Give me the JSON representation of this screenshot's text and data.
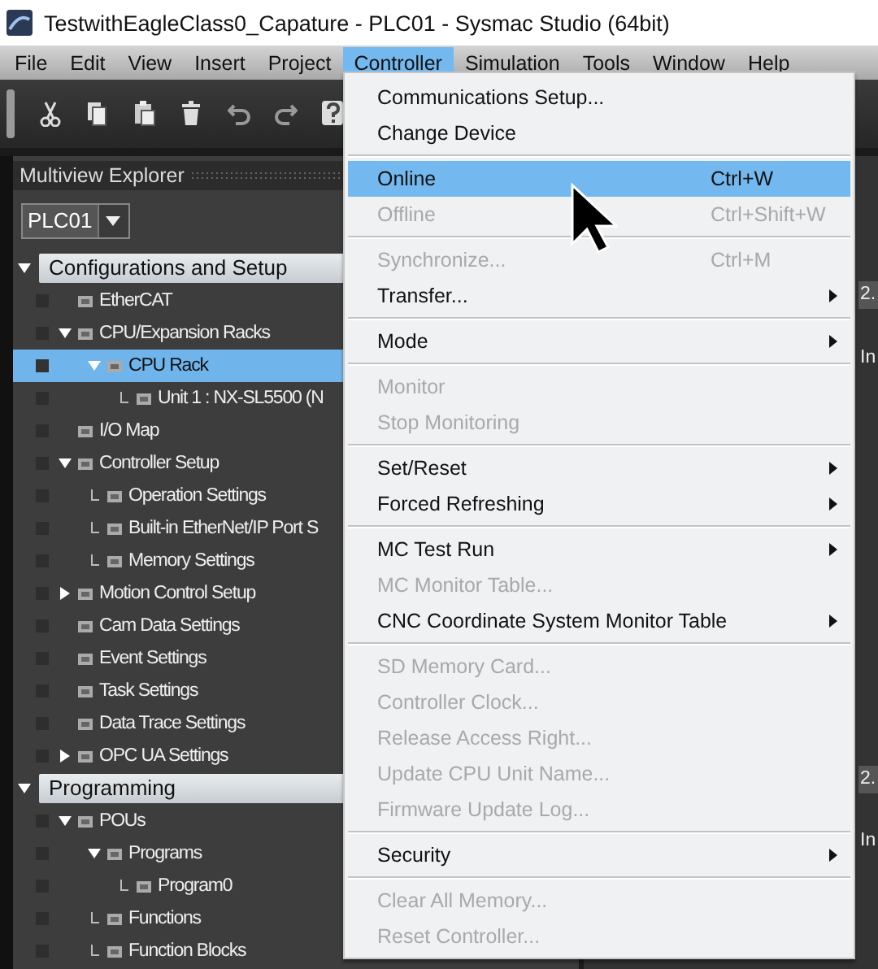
{
  "window": {
    "title": "TestwithEagleClass0_Capature - PLC01 - Sysmac Studio (64bit)"
  },
  "menu_bar": [
    {
      "label": "File",
      "selected": false
    },
    {
      "label": "Edit",
      "selected": false
    },
    {
      "label": "View",
      "selected": false
    },
    {
      "label": "Insert",
      "selected": false
    },
    {
      "label": "Project",
      "selected": false
    },
    {
      "label": "Controller",
      "selected": true
    },
    {
      "label": "Simulation",
      "selected": false
    },
    {
      "label": "Tools",
      "selected": false
    },
    {
      "label": "Window",
      "selected": false
    },
    {
      "label": "Help",
      "selected": false
    }
  ],
  "explorer": {
    "title": "Multiview Explorer",
    "device": "PLC01",
    "sections": [
      {
        "label": "Configurations and Setup",
        "expanded": true,
        "children": [
          {
            "label": "EtherCAT",
            "selected": false
          },
          {
            "label": "CPU/Expansion Racks",
            "selected": false,
            "expanded": true,
            "children": [
              {
                "label": "CPU Rack",
                "selected": true,
                "expanded": true,
                "children": [
                  {
                    "label": "Unit 1 : NX-SL5500 (N",
                    "selected": false
                  }
                ]
              }
            ]
          },
          {
            "label": "I/O Map",
            "selected": false
          },
          {
            "label": "Controller Setup",
            "selected": false,
            "expanded": true,
            "children": [
              {
                "label": "Operation Settings",
                "selected": false
              },
              {
                "label": "Built-in EtherNet/IP Port S",
                "selected": false
              },
              {
                "label": "Memory Settings",
                "selected": false
              }
            ]
          },
          {
            "label": "Motion Control Setup",
            "selected": false,
            "expanded": false
          },
          {
            "label": "Cam Data Settings",
            "selected": false
          },
          {
            "label": "Event Settings",
            "selected": false
          },
          {
            "label": "Task Settings",
            "selected": false
          },
          {
            "label": "Data Trace Settings",
            "selected": false
          },
          {
            "label": "OPC UA Settings",
            "selected": false,
            "expanded": false
          }
        ]
      },
      {
        "label": "Programming",
        "expanded": true,
        "children": [
          {
            "label": "POUs",
            "selected": false,
            "expanded": true,
            "children": [
              {
                "label": "Programs",
                "selected": false,
                "expanded": true,
                "children": [
                  {
                    "label": "Program0",
                    "selected": false
                  }
                ]
              },
              {
                "label": "Functions",
                "selected": false
              },
              {
                "label": "Function Blocks",
                "selected": false
              }
            ]
          }
        ]
      }
    ]
  },
  "workspace": {
    "fragments": [
      "2.",
      "In",
      "2.",
      "In"
    ]
  },
  "controller_menu": [
    {
      "kind": "item",
      "label": "Communications Setup...",
      "disabled": false,
      "selected": false
    },
    {
      "kind": "item",
      "label": "Change Device",
      "disabled": false,
      "selected": false
    },
    {
      "kind": "separator"
    },
    {
      "kind": "item",
      "label": "Online",
      "shortcut": "Ctrl+W",
      "disabled": false,
      "selected": true
    },
    {
      "kind": "item",
      "label": "Offline",
      "shortcut": "Ctrl+Shift+W",
      "disabled": true,
      "selected": false
    },
    {
      "kind": "separator"
    },
    {
      "kind": "item",
      "label": "Synchronize...",
      "shortcut": "Ctrl+M",
      "disabled": true,
      "selected": false
    },
    {
      "kind": "submenu",
      "label": "Transfer...",
      "disabled": false,
      "selected": false
    },
    {
      "kind": "separator"
    },
    {
      "kind": "submenu",
      "label": "Mode",
      "disabled": false,
      "selected": false
    },
    {
      "kind": "separator"
    },
    {
      "kind": "item",
      "label": "Monitor",
      "disabled": true,
      "selected": false
    },
    {
      "kind": "item",
      "label": "Stop Monitoring",
      "disabled": true,
      "selected": false
    },
    {
      "kind": "separator"
    },
    {
      "kind": "submenu",
      "label": "Set/Reset",
      "disabled": false,
      "selected": false
    },
    {
      "kind": "submenu",
      "label": "Forced Refreshing",
      "disabled": false,
      "selected": false
    },
    {
      "kind": "separator"
    },
    {
      "kind": "submenu",
      "label": "MC Test Run",
      "disabled": false,
      "selected": false
    },
    {
      "kind": "item",
      "label": "MC Monitor Table...",
      "disabled": true,
      "selected": false
    },
    {
      "kind": "submenu",
      "label": "CNC Coordinate System Monitor Table",
      "disabled": false,
      "selected": false
    },
    {
      "kind": "separator"
    },
    {
      "kind": "item",
      "label": "SD Memory Card...",
      "disabled": true,
      "selected": false
    },
    {
      "kind": "item",
      "label": "Controller Clock...",
      "disabled": true,
      "selected": false
    },
    {
      "kind": "item",
      "label": "Release Access Right...",
      "disabled": true,
      "selected": false
    },
    {
      "kind": "item",
      "label": "Update CPU Unit Name...",
      "disabled": true,
      "selected": false
    },
    {
      "kind": "item",
      "label": "Firmware Update Log...",
      "disabled": true,
      "selected": false
    },
    {
      "kind": "separator"
    },
    {
      "kind": "submenu",
      "label": "Security",
      "disabled": false,
      "selected": false
    },
    {
      "kind": "separator"
    },
    {
      "kind": "item",
      "label": "Clear All Memory...",
      "disabled": true,
      "selected": false
    },
    {
      "kind": "item",
      "label": "Reset Controller...",
      "disabled": true,
      "selected": false
    }
  ]
}
